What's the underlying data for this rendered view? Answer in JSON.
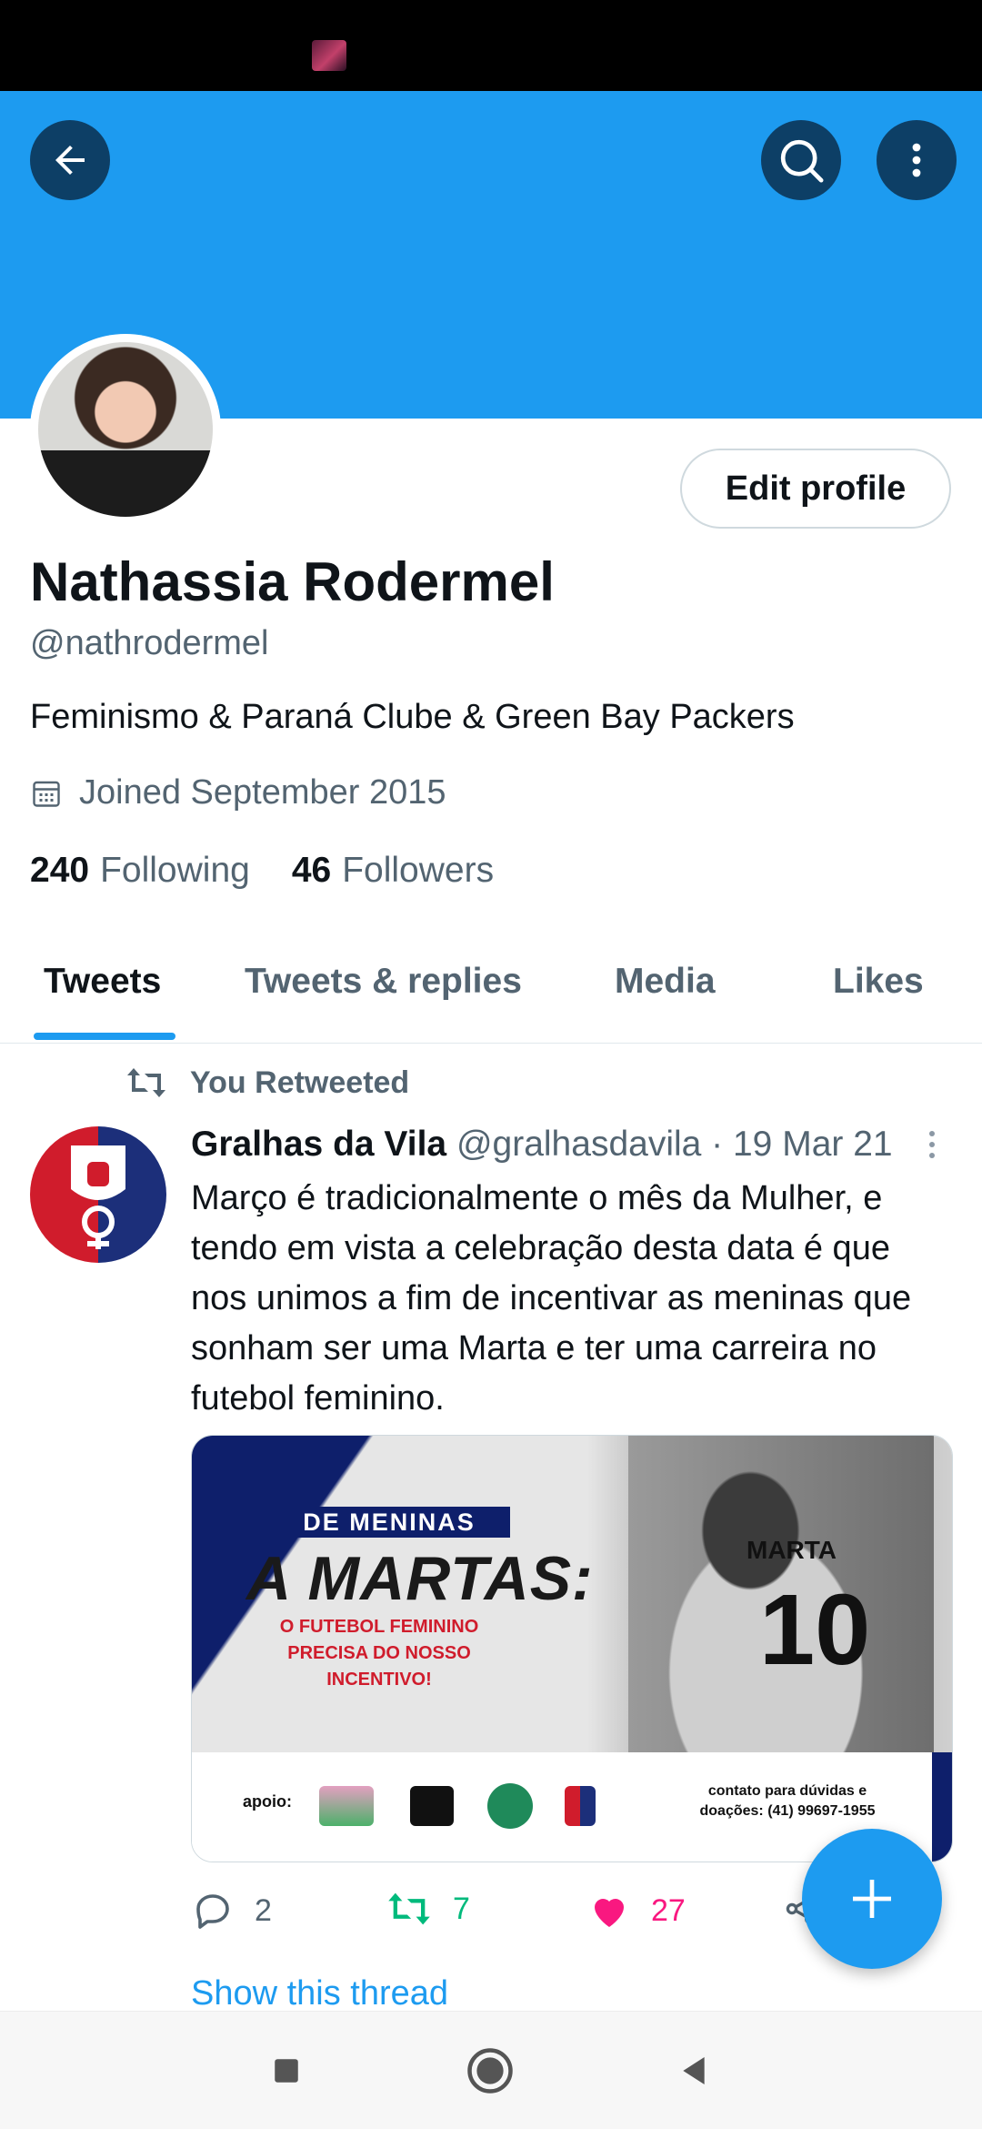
{
  "profile": {
    "name": "Nathassia Rodermel",
    "handle": "@nathrodermel",
    "bio": "Feminismo & Paraná Clube & Green Bay Packers",
    "joined": "Joined September 2015",
    "following_count": "240",
    "following_label": "Following",
    "followers_count": "46",
    "followers_label": "Followers",
    "edit_profile_label": "Edit profile"
  },
  "tabs": [
    {
      "label": "Tweets",
      "active": true
    },
    {
      "label": "Tweets & replies",
      "active": false
    },
    {
      "label": "Media",
      "active": false
    },
    {
      "label": "Likes",
      "active": false
    }
  ],
  "tweet": {
    "retweet_note": "You Retweeted",
    "author": "Gralhas da Vila",
    "meta": "@gralhasdavila · 19 Mar 21",
    "text": "Março é tradicionalmente o mês da Mulher, e tendo em vista a celebração desta data é que nos unimos a fim de incentivar as meninas que sonham ser uma Marta e ter uma carreira no futebol feminino.",
    "media": {
      "label": "DE MENINAS",
      "title": "A MARTAS:",
      "subtitle": "O FUTEBOL FEMININO PRECISA DO NOSSO INCENTIVO!",
      "shirt_name": "MARTA",
      "shirt_number": "10",
      "apoio": "apoio:",
      "contact": "contato para dúvidas e doações: (41) 99697-1955"
    },
    "replies": "2",
    "retweets": "7",
    "likes": "27",
    "show_thread": "Show this thread"
  },
  "colors": {
    "accent": "#1d9bf0",
    "retweet": "#00ba7c",
    "like": "#f91880",
    "secondary_text": "#536471"
  },
  "icons": {
    "back": "arrow-left-icon",
    "search": "search-icon",
    "more": "more-vertical-icon",
    "calendar": "calendar-icon",
    "retweet": "retweet-icon",
    "reply": "reply-icon",
    "like": "heart-icon",
    "share": "share-icon",
    "compose": "plus-icon"
  }
}
